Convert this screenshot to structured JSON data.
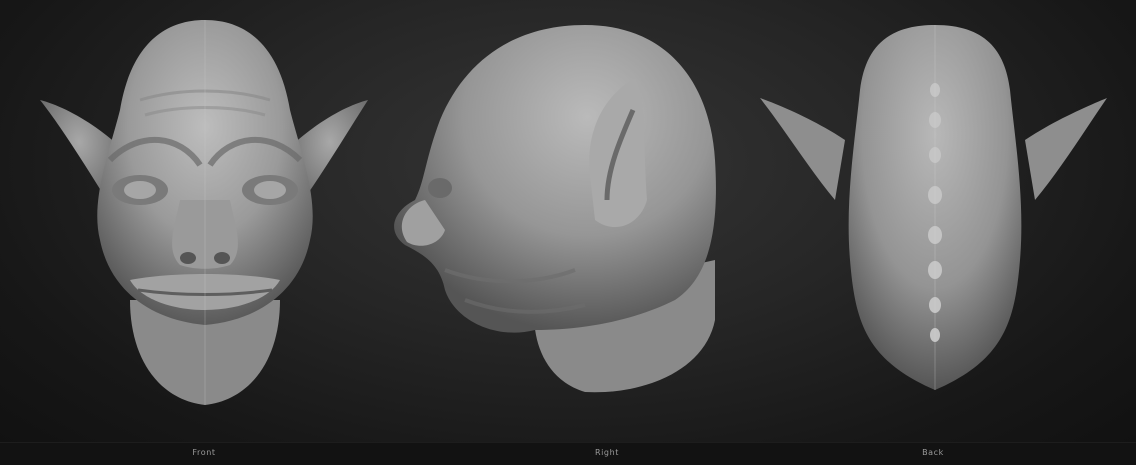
{
  "views": [
    {
      "id": "front",
      "label": "Front"
    },
    {
      "id": "right",
      "label": "Right"
    },
    {
      "id": "back",
      "label": "Back"
    }
  ],
  "colors": {
    "background_center": "#353535",
    "background_edge": "#101010",
    "clay_light": "#b4b4b4",
    "clay_mid": "#8f8f8f",
    "clay_dark": "#555555",
    "caption_text": "#9a9a9a"
  }
}
